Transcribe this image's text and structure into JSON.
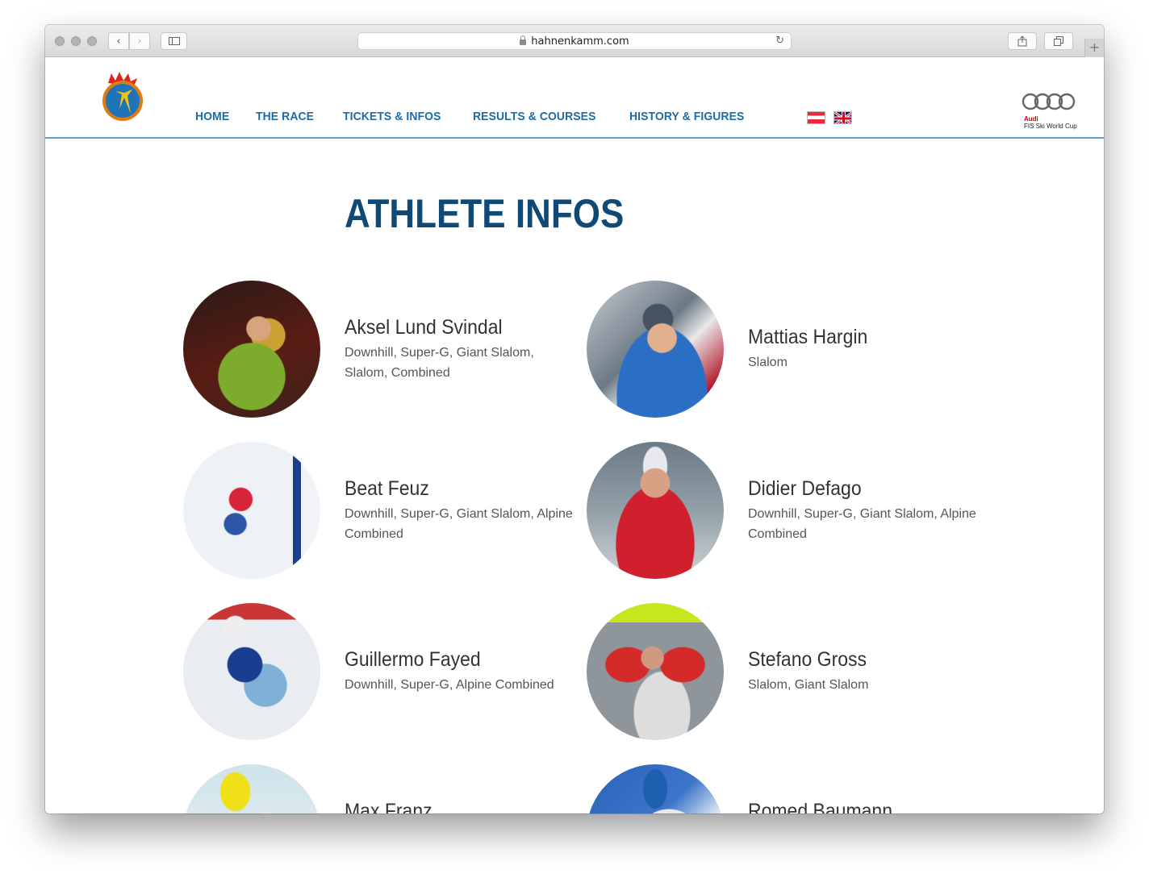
{
  "browser": {
    "url": "hahnenkamm.com"
  },
  "nav": {
    "items": [
      "HOME",
      "THE RACE",
      "TICKETS & INFOS",
      "RESULTS & COURSES",
      "HISTORY & FIGURES"
    ]
  },
  "sponsor": {
    "line1": "Audi",
    "line2": "FIS Ski World Cup"
  },
  "page": {
    "title": "ATHLETE INFOS"
  },
  "athletes": [
    {
      "name": "Aksel Lund Svindal",
      "disciplines": "Downhill, Super-G, Giant Slalom, Slalom, Combined"
    },
    {
      "name": "Mattias Hargin",
      "disciplines": "Slalom"
    },
    {
      "name": "Beat Feuz",
      "disciplines": "Downhill, Super-G, Giant Slalom, Alpine Combined"
    },
    {
      "name": "Didier Defago",
      "disciplines": "Downhill, Super-G, Giant Slalom, Alpine Combined"
    },
    {
      "name": "Guillermo Fayed",
      "disciplines": "Downhill, Super-G, Alpine Combined"
    },
    {
      "name": "Stefano Gross",
      "disciplines": "Slalom, Giant Slalom"
    },
    {
      "name": "Max Franz",
      "disciplines": ""
    },
    {
      "name": "Romed Baumann",
      "disciplines": ""
    }
  ],
  "colors": {
    "nav": "#1c6ca5",
    "title": "#0f4a76",
    "header_rule": "#5fa1c6"
  }
}
